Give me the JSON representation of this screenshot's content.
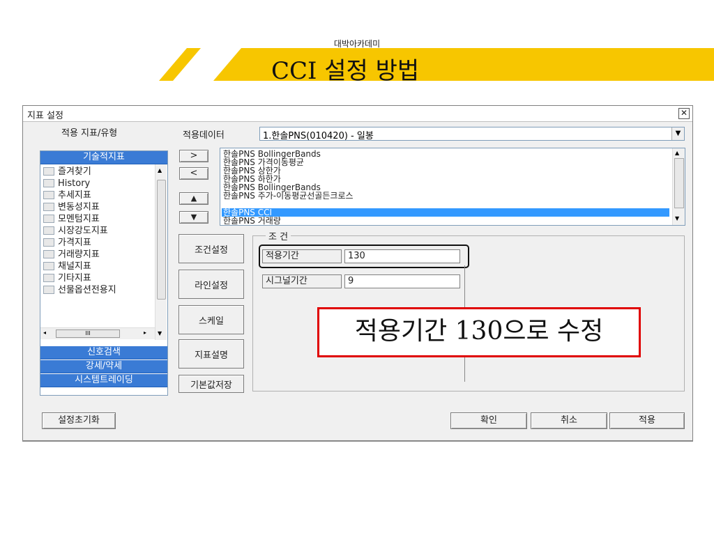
{
  "header": {
    "subtitle": "대박아카데미",
    "title": "CCI 설정 방법"
  },
  "dialog": {
    "title": "지표 설정",
    "close_glyph": "✕",
    "left": {
      "section_label": "적용 지표/유형",
      "category_top": "기술적지표",
      "tree_items": [
        "즐겨찾기",
        "History",
        "추세지표",
        "변동성지표",
        "모멘텀지표",
        "시장강도지표",
        "가격지표",
        "거래량지표",
        "채널지표",
        "기타지표",
        "선물옵션전용지"
      ],
      "hscroll_glyph": "III",
      "categories_bottom": [
        "신호검색",
        "강세/약세",
        "시스템트레이딩"
      ]
    },
    "data_label": "적용데이터",
    "data_value": "1.한솔PNS(010420) - 일봉",
    "move_buttons": [
      ">",
      "<",
      "▲",
      "▼"
    ],
    "indicator_list": [
      "한솔PNS BollingerBands",
      "한솔PNS 가격이동평균",
      "한솔PNS 상한가",
      "한솔PNS 하한가",
      "한솔PNS BollingerBands",
      "한솔PNS 주가-이동평균선골든크로스",
      "한솔PNS CCI",
      "한솔PNS 거래량"
    ],
    "selected_index": 6,
    "side_buttons": [
      "조건설정",
      "라인설정",
      "스케일",
      "지표설명",
      "기본값저장"
    ],
    "condition": {
      "title": "조 건",
      "period_label": "적용기간",
      "period_value": "130",
      "signal_label": "시그널기간",
      "signal_value": "9"
    },
    "annotation": "적용기간 130으로 수정",
    "footer": {
      "reset": "설정초기화",
      "ok": "확인",
      "cancel": "취소",
      "apply": "적용"
    }
  }
}
